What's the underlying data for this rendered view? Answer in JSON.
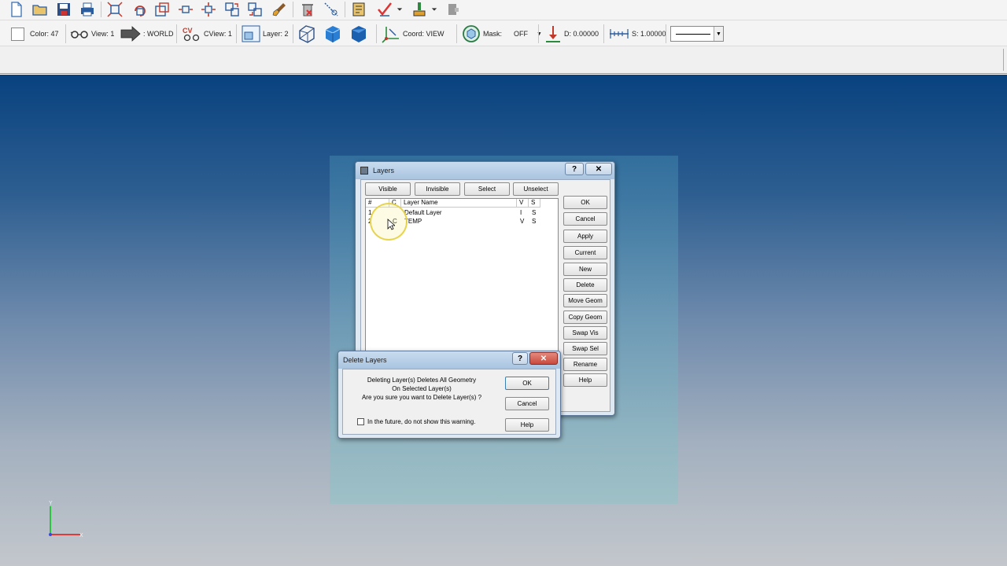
{
  "toolbar_row2": {
    "color_label": "Color: 47",
    "view_label": "View: 1",
    "world_label": ": WORLD",
    "cview_label": "CView: 1",
    "layer_label": "Layer: 2",
    "coord_label": "Coord: VIEW",
    "mask_label": "Mask:",
    "mask_value": "OFF",
    "depth_label": "D: 0.00000",
    "scale_label": "S: 1.00000"
  },
  "layers_dialog": {
    "title": "Layers",
    "help_btn": "?",
    "close_btn": "✕",
    "top_buttons": [
      "Visible",
      "Invisible",
      "Select",
      "Unselect"
    ],
    "columns": [
      "#",
      "C",
      "Layer Name",
      "V",
      "S"
    ],
    "rows": [
      {
        "num": "1",
        "c": "",
        "name": "Default Layer",
        "v": "I",
        "s": "S"
      },
      {
        "num": "2",
        "c": "C",
        "name": "TEMP",
        "v": "V",
        "s": "S"
      }
    ],
    "side_buttons": [
      "OK",
      "Cancel",
      "Apply",
      "Current",
      "New",
      "Delete",
      "Move Geom",
      "Copy Geom",
      "Swap Vis",
      "Swap Sel",
      "Rename",
      "Help"
    ]
  },
  "delete_dialog": {
    "title": "Delete Layers",
    "help_btn": "?",
    "close_btn": "✕",
    "message_line1": "Deleting Layer(s) Deletes All Geometry",
    "message_line2": "On Selected Layer(s)",
    "message_line3": "Are you sure you want to Delete Layer(s) ?",
    "checkbox_label": "In the future, do not show this warning.",
    "ok": "OK",
    "cancel": "Cancel",
    "help": "Help"
  },
  "axis": {
    "y_label": "Y",
    "x_label": "X"
  },
  "colors": {
    "viewport_top": "#08427f",
    "viewport_bottom": "#c3c7cc",
    "close_red": "#c94a3e"
  }
}
